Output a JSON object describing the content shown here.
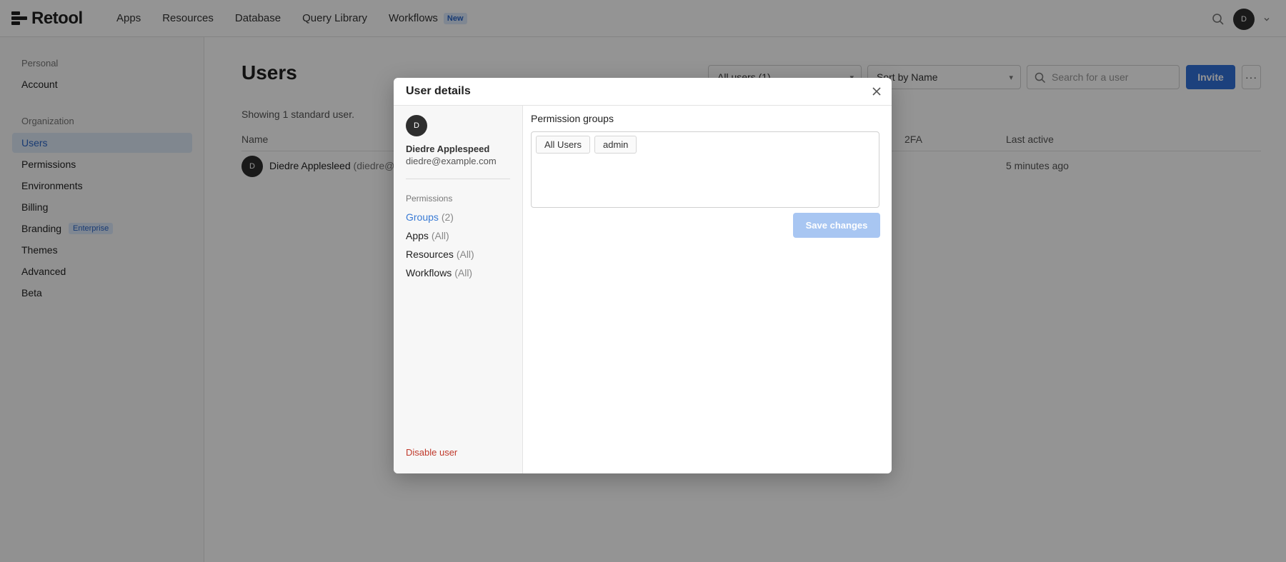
{
  "app": {
    "name": "Retool"
  },
  "nav": {
    "links": [
      "Apps",
      "Resources",
      "Database",
      "Query Library",
      "Workflows"
    ],
    "workflows_badge": "New",
    "avatar_initial": "D"
  },
  "sidebar": {
    "personal_label": "Personal",
    "account": "Account",
    "organization_label": "Organization",
    "items": [
      "Users",
      "Permissions",
      "Environments",
      "Billing",
      "Branding",
      "Themes",
      "Advanced",
      "Beta"
    ],
    "branding_badge": "Enterprise"
  },
  "main": {
    "title": "Users",
    "filter_select": "All users (1)",
    "sort_select": "Sort by Name",
    "search_placeholder": "Search for a user",
    "invite_label": "Invite",
    "more_label": "···",
    "showing": "Showing 1 standard user.",
    "columns": {
      "name": "Name",
      "twofa": "2FA",
      "last_active": "Last active"
    },
    "rows": [
      {
        "initial": "D",
        "name": "Diedre Applesleed",
        "email": "(diedre@e",
        "last_active": "5 minutes ago"
      }
    ]
  },
  "modal": {
    "title": "User details",
    "user_initial": "D",
    "user_name": "Diedre Applespeed",
    "user_email": "diedre@example.com",
    "permissions_label": "Permissions",
    "perm_items": [
      {
        "label": "Groups",
        "count": "(2)"
      },
      {
        "label": "Apps",
        "count": "(All)"
      },
      {
        "label": "Resources",
        "count": "(All)"
      },
      {
        "label": "Workflows",
        "count": "(All)"
      }
    ],
    "disable_user": "Disable user",
    "permission_groups_title": "Permission groups",
    "groups": [
      "All Users",
      "admin"
    ],
    "save_label": "Save changes"
  },
  "colors": {
    "accent": "#3170d8",
    "danger": "#c0392b"
  }
}
